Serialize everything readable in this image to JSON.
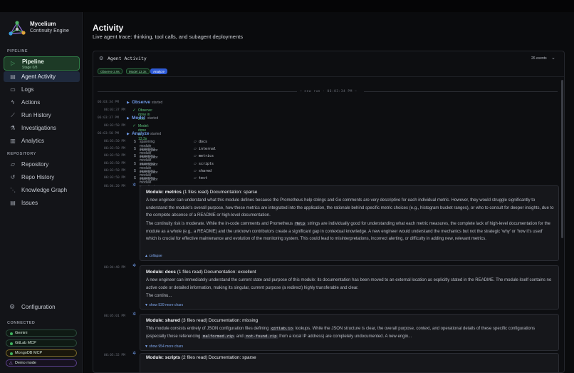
{
  "brand": {
    "name": "Mycelium",
    "sub": "Continuity Engine"
  },
  "sidebar": {
    "pipeline_label": "PIPELINE",
    "pipeline_button": {
      "title": "Pipeline",
      "sub": "Stage 0/8"
    },
    "items": [
      {
        "label": "Agent Activity",
        "icon": "activity-icon"
      },
      {
        "label": "Logs",
        "icon": "logs-icon"
      },
      {
        "label": "Actions",
        "icon": "bolt-icon"
      },
      {
        "label": "Run History",
        "icon": "trend-icon"
      },
      {
        "label": "Investigations",
        "icon": "flask-icon"
      },
      {
        "label": "Analytics",
        "icon": "bar-chart-icon"
      }
    ],
    "repository_label": "REPOSITORY",
    "repo_items": [
      {
        "label": "Repository",
        "icon": "folder-icon"
      },
      {
        "label": "Repo History",
        "icon": "history-icon"
      },
      {
        "label": "Knowledge Graph",
        "icon": "graph-icon"
      },
      {
        "label": "Issues",
        "icon": "document-icon"
      }
    ],
    "configuration": "Configuration",
    "connected_label": "CONNECTED",
    "connected": [
      "Gemini",
      "GitLab MCP",
      "MongoDB MCP",
      "Demo mode"
    ]
  },
  "header": {
    "title": "Activity",
    "subtitle": "Live agent trace: thinking, tool calls, and subagent deployments"
  },
  "panel": {
    "title": "Agent Activity",
    "events": "26 events",
    "tags": [
      "Observe 2.9s",
      "Model 13.3s",
      "Analyze"
    ],
    "new_run": "— new run · 06:03:34 PM —"
  },
  "trace": [
    {
      "ts": "06:03:34 PM",
      "phase": "Observe",
      "status": "started"
    },
    {
      "ts": "06:03:37 PM",
      "done": "Observe: done in 2.9s"
    },
    {
      "ts": "06:03:37 PM",
      "phase": "Model",
      "status": "started"
    },
    {
      "ts": "06:03:50 PM",
      "done": "Model: done in 13.3s"
    },
    {
      "ts": "06:03:50 PM",
      "phase": "Analyze",
      "status": "started"
    },
    {
      "ts": "06:03:50 PM",
      "spawn": "spawning module investigator",
      "module": "docs"
    },
    {
      "ts": "06:03:50 PM",
      "spawn": "spawning module investigator",
      "module": "internal"
    },
    {
      "ts": "06:03:50 PM",
      "spawn": "spawning module investigator",
      "module": "metrics"
    },
    {
      "ts": "06:03:50 PM",
      "spawn": "spawning module investigator",
      "module": "scripts"
    },
    {
      "ts": "06:03:50 PM",
      "spawn": "spawning module investigator",
      "module": "shared"
    },
    {
      "ts": "06:03:50 PM",
      "spawn": "spawning module investigator",
      "module": "test"
    }
  ],
  "cards": [
    {
      "ts": "06:04:20 PM",
      "module": "Module: metrics",
      "meta": " (1 files read) Documentation: sparse",
      "p1": "A new engineer can understand what this module defines because the Prometheus help strings and Go comments are very descriptive for each individual metric. However, they would struggle significantly to understand the module's overall purpose, how these metrics are integrated into the application, the rationale behind specific metric choices (e.g., histogram bucket ranges), or who to consult for deeper insights, due to the complete absence of a README or high-level documentation.",
      "p2a": "The continuity risk is moderate. While the in-code comments and Prometheus ",
      "p2code": "Help",
      "p2b": " strings are individually good for understanding what each metric measures, the complete lack of high-level documentation for the module as a whole (e.g., a README) and the unknown contributors create a significant gap in contextual knowledge. A new engineer would understand the mechanics but not the strategic 'why' or 'how it's used' which is crucial for effective maintenance and evolution of the monitoring system. This could lead to misinterpretations, incorrect alerting, or difficulty in adding new, relevant metrics.",
      "more": "▲ collapse"
    },
    {
      "ts": "06:04:48 PM",
      "module": "Module: docs",
      "meta": " (1 files read) Documentation: excellent",
      "p1": "A new engineer can immediately understand the current state and purpose of this module: its documentation has been moved to an external location as explicitly stated in the README. The module itself contains no active code or detailed information, making its singular, current purpose (a redirect) highly transferable and clear.",
      "p2": "The continu...",
      "more": "▼ show 539 more chars"
    },
    {
      "ts": "06:05:01 PM",
      "module": "Module: shared",
      "meta": " (3 files read) Documentation: missing",
      "p1a": "This module consists entirely of JSON configuration files defining ",
      "code1": "gitlab.io",
      "p1b": " lookups. While the JSON structure is clear, the overall purpose, context, and operational details of these specific configurations (especially those referencing ",
      "code2": "malformed.zip",
      "p1c": " and ",
      "code3": "not-found.zip",
      "p1d": " from a local IP address) are completely undocumented. A new engin...",
      "more": "▼ show 954 more chars"
    },
    {
      "ts": "06:05:32 PM",
      "module": "Module: scripts",
      "meta": " (2 files read) Documentation: sparse"
    }
  ]
}
